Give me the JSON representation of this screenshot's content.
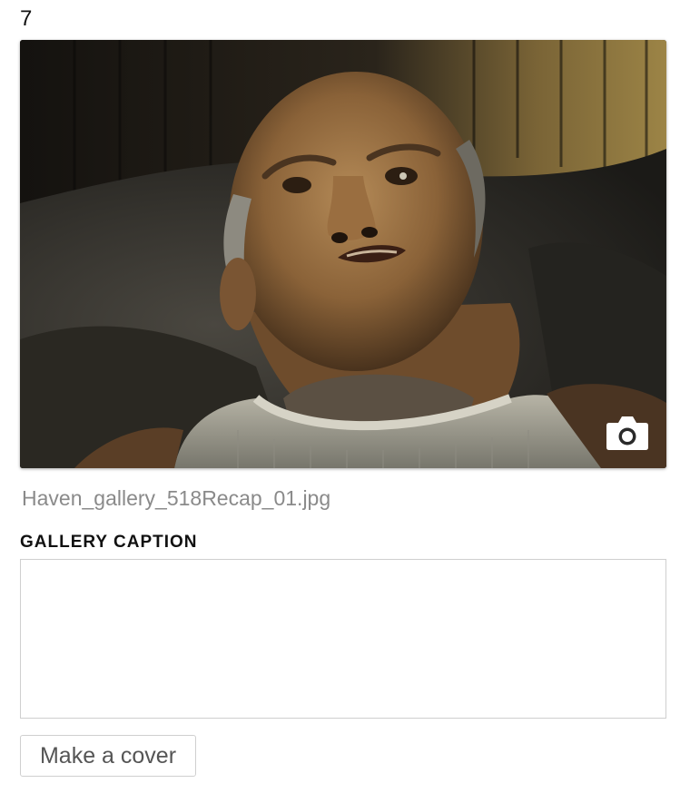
{
  "item": {
    "index": "7",
    "filename": "Haven_gallery_518Recap_01.jpg"
  },
  "photo": {
    "icon": "camera-icon"
  },
  "caption": {
    "label": "GALLERY CAPTION",
    "value": "",
    "placeholder": ""
  },
  "actions": {
    "make_cover_label": "Make a cover"
  },
  "colors": {
    "filename_text": "#8a8a8a",
    "border": "#cfcfcf",
    "button_text": "#555555"
  }
}
